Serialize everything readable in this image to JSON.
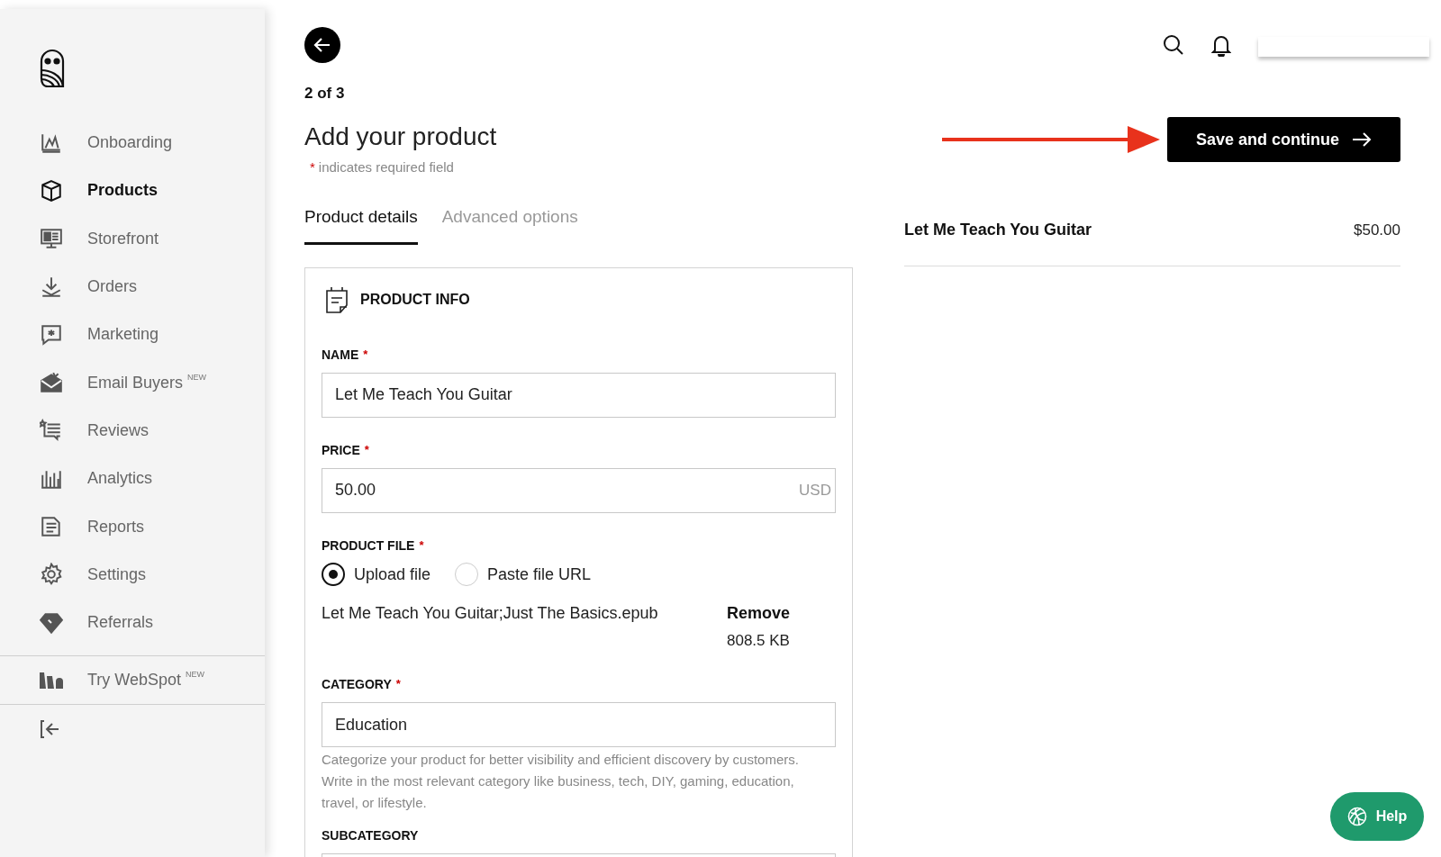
{
  "sidebar": {
    "items": [
      {
        "label": "Onboarding",
        "selected": false
      },
      {
        "label": "Products",
        "selected": true
      },
      {
        "label": "Storefront",
        "selected": false
      },
      {
        "label": "Orders",
        "selected": false
      },
      {
        "label": "Marketing",
        "selected": false
      },
      {
        "label": "Email Buyers",
        "badge": "NEW",
        "selected": false
      },
      {
        "label": "Reviews",
        "selected": false
      },
      {
        "label": "Analytics",
        "selected": false
      },
      {
        "label": "Reports",
        "selected": false
      },
      {
        "label": "Settings",
        "selected": false
      },
      {
        "label": "Referrals",
        "selected": false
      }
    ],
    "promo": {
      "label": "Try WebSpot",
      "badge": "NEW"
    }
  },
  "step": "2 of 3",
  "title": "Add your product",
  "required_note": {
    "mark": "*",
    "text": "indicates required field"
  },
  "tabs": [
    {
      "label": "Product details",
      "selected": true
    },
    {
      "label": "Advanced options",
      "selected": false
    }
  ],
  "card": {
    "title": "PRODUCT INFO",
    "fields": [
      {
        "kind": "text",
        "label": "NAME",
        "required_mark": "*",
        "value": "Let Me Teach You Guitar"
      },
      {
        "kind": "text",
        "label": "PRICE",
        "required_mark": "*",
        "value": "50.00",
        "suffix": "USD"
      },
      {
        "kind": "file",
        "label": "PRODUCT FILE",
        "required_mark": "*",
        "options": [
          {
            "label": "Upload file",
            "selected": true
          },
          {
            "label": "Paste file URL",
            "selected": false
          }
        ],
        "file_name": "Let Me Teach You Guitar;Just The Basics.epub",
        "remove": "Remove",
        "file_size": "808.5 KB"
      },
      {
        "kind": "text",
        "label": "CATEGORY",
        "required_mark": "*",
        "value": "Education",
        "help": "Categorize your product for better visibility and efficient discovery by customers. Write in the most relevant category like business, tech, DIY, gaming, education, travel, or lifestyle."
      },
      {
        "kind": "cut",
        "label": "SUBCATEGORY"
      }
    ]
  },
  "save_button": "Save and continue",
  "summary": {
    "name": "Let Me Teach You Guitar",
    "price": "$50.00"
  },
  "help_button": "Help"
}
